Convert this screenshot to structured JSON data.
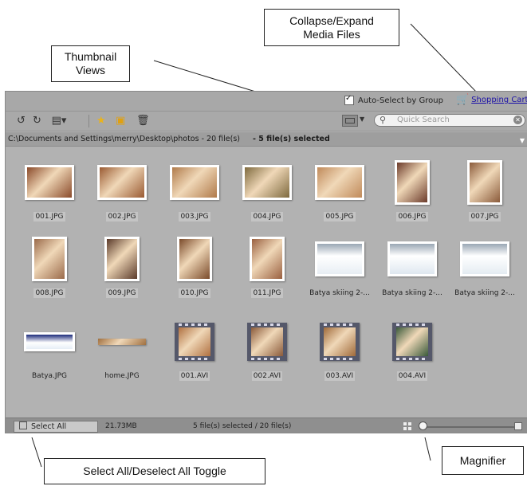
{
  "callouts": {
    "collapse_expand": "Collapse/Expand\nMedia Files",
    "thumbnail_views": "Thumbnail\nViews",
    "select_all_toggle": "Select All/Deselect All Toggle",
    "magnifier": "Magnifier"
  },
  "topbar": {
    "auto_select_label": "Auto-Select by Group",
    "auto_select_checked": true,
    "shopping_cart_label": "Shopping Cart"
  },
  "toolbar": {
    "icons": [
      "rotate-left-icon",
      "rotate-right-icon",
      "view-menu-icon",
      "star-icon",
      "lock-icon",
      "trash-icon"
    ]
  },
  "search": {
    "placeholder": "Quick Search"
  },
  "pathbar": {
    "path": "C:\\Documents and Settings\\merry\\Desktop\\photos - 20 file(s)",
    "selected": "- 5 file(s) selected"
  },
  "files": [
    {
      "name": "001.JPG",
      "selected": true,
      "kind": "photo",
      "orientation": "landscape",
      "tone": "#8a4a2a"
    },
    {
      "name": "002.JPG",
      "selected": true,
      "kind": "photo",
      "orientation": "landscape",
      "tone": "#9a5a32"
    },
    {
      "name": "003.JPG",
      "selected": true,
      "kind": "photo",
      "orientation": "landscape",
      "tone": "#b07a4a"
    },
    {
      "name": "004.JPG",
      "selected": true,
      "kind": "photo",
      "orientation": "landscape",
      "tone": "#7e6a3e"
    },
    {
      "name": "005.JPG",
      "selected": true,
      "kind": "photo",
      "orientation": "landscape",
      "tone": "#c08a5a"
    },
    {
      "name": "006.JPG",
      "selected": false,
      "kind": "photo",
      "orientation": "portrait",
      "tone": "#6b3a2a"
    },
    {
      "name": "007.JPG",
      "selected": false,
      "kind": "photo",
      "orientation": "portrait",
      "tone": "#8a5a3a"
    },
    {
      "name": "008.JPG",
      "selected": false,
      "kind": "photo",
      "orientation": "portrait",
      "tone": "#9a6a4a"
    },
    {
      "name": "009.JPG",
      "selected": false,
      "kind": "photo",
      "orientation": "portrait",
      "tone": "#5a3a2a"
    },
    {
      "name": "010.JPG",
      "selected": false,
      "kind": "photo",
      "orientation": "portrait",
      "tone": "#7a4a2a"
    },
    {
      "name": "011.JPG",
      "selected": false,
      "kind": "photo",
      "orientation": "portrait",
      "tone": "#9a6040"
    },
    {
      "name": "Batya skiing 2-...",
      "selected": false,
      "kind": "photo",
      "orientation": "landscape",
      "tone": "#e8eef4"
    },
    {
      "name": "Batya skiing 2-...",
      "selected": false,
      "kind": "photo",
      "orientation": "landscape",
      "tone": "#dfe8f0"
    },
    {
      "name": "Batya skiing 2-...",
      "selected": false,
      "kind": "photo",
      "orientation": "landscape",
      "tone": "#e4ecf2"
    },
    {
      "name": "Batya.JPG",
      "selected": false,
      "kind": "photo",
      "orientation": "panorama",
      "tone": "#2a3a8a"
    },
    {
      "name": "home.JPG",
      "selected": false,
      "kind": "photo",
      "orientation": "strip",
      "tone": "#a07040"
    },
    {
      "name": "001.AVI",
      "selected": false,
      "kind": "video",
      "tone": "#b07040"
    },
    {
      "name": "002.AVI",
      "selected": false,
      "kind": "video",
      "tone": "#8a5a3a"
    },
    {
      "name": "003.AVI",
      "selected": false,
      "kind": "video",
      "tone": "#a06a3a"
    },
    {
      "name": "004.AVI",
      "selected": false,
      "kind": "video",
      "tone": "#3a5a3a"
    }
  ],
  "status": {
    "select_all_label": "Select All",
    "total_size": "21.73MB",
    "selection_count": "5 file(s) selected / 20 file(s)",
    "magnifier_level": 0.0
  }
}
